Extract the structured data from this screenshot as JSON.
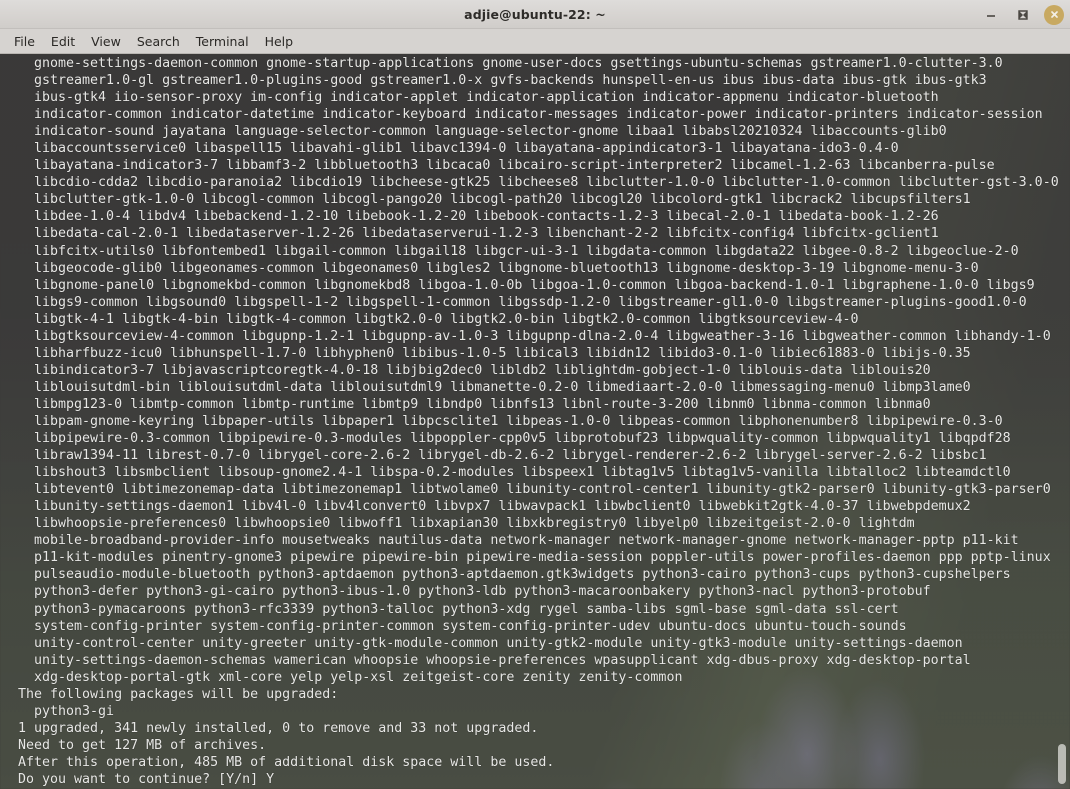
{
  "window": {
    "title": "adjie@ubuntu-22: ~",
    "controls": [
      {
        "name": "minimize",
        "glyph": "minimize-icon"
      },
      {
        "name": "maximize",
        "glyph": "maximize-icon"
      },
      {
        "name": "close",
        "glyph": "close-icon"
      }
    ],
    "close_button_color": "#c8a961",
    "titlebar_color": "#d6d3d0"
  },
  "menubar": {
    "items": [
      {
        "label": "File"
      },
      {
        "label": "Edit"
      },
      {
        "label": "View"
      },
      {
        "label": "Search"
      },
      {
        "label": "Terminal"
      },
      {
        "label": "Help"
      }
    ]
  },
  "terminal": {
    "background_color": "#3b3b38",
    "foreground_color": "#e8e8e6",
    "lines": [
      "  gnome-settings-daemon-common gnome-startup-applications gnome-user-docs gsettings-ubuntu-schemas gstreamer1.0-clutter-3.0",
      "  gstreamer1.0-gl gstreamer1.0-plugins-good gstreamer1.0-x gvfs-backends hunspell-en-us ibus ibus-data ibus-gtk ibus-gtk3",
      "  ibus-gtk4 iio-sensor-proxy im-config indicator-applet indicator-application indicator-appmenu indicator-bluetooth",
      "  indicator-common indicator-datetime indicator-keyboard indicator-messages indicator-power indicator-printers indicator-session",
      "  indicator-sound jayatana language-selector-common language-selector-gnome libaa1 libabsl20210324 libaccounts-glib0",
      "  libaccountsservice0 libaspell15 libavahi-glib1 libavc1394-0 libayatana-appindicator3-1 libayatana-ido3-0.4-0",
      "  libayatana-indicator3-7 libbamf3-2 libbluetooth3 libcaca0 libcairo-script-interpreter2 libcamel-1.2-63 libcanberra-pulse",
      "  libcdio-cdda2 libcdio-paranoia2 libcdio19 libcheese-gtk25 libcheese8 libclutter-1.0-0 libclutter-1.0-common libclutter-gst-3.0-0",
      "  libclutter-gtk-1.0-0 libcogl-common libcogl-pango20 libcogl-path20 libcogl20 libcolord-gtk1 libcrack2 libcupsfilters1",
      "  libdee-1.0-4 libdv4 libebackend-1.2-10 libebook-1.2-20 libebook-contacts-1.2-3 libecal-2.0-1 libedata-book-1.2-26",
      "  libedata-cal-2.0-1 libedataserver-1.2-26 libedataserverui-1.2-3 libenchant-2-2 libfcitx-config4 libfcitx-gclient1",
      "  libfcitx-utils0 libfontembed1 libgail-common libgail18 libgcr-ui-3-1 libgdata-common libgdata22 libgee-0.8-2 libgeoclue-2-0",
      "  libgeocode-glib0 libgeonames-common libgeonames0 libgles2 libgnome-bluetooth13 libgnome-desktop-3-19 libgnome-menu-3-0",
      "  libgnome-panel0 libgnomekbd-common libgnomekbd8 libgoa-1.0-0b libgoa-1.0-common libgoa-backend-1.0-1 libgraphene-1.0-0 libgs9",
      "  libgs9-common libgsound0 libgspell-1-2 libgspell-1-common libgssdp-1.2-0 libgstreamer-gl1.0-0 libgstreamer-plugins-good1.0-0",
      "  libgtk-4-1 libgtk-4-bin libgtk-4-common libgtk2.0-0 libgtk2.0-bin libgtk2.0-common libgtksourceview-4-0",
      "  libgtksourceview-4-common libgupnp-1.2-1 libgupnp-av-1.0-3 libgupnp-dlna-2.0-4 libgweather-3-16 libgweather-common libhandy-1-0",
      "  libharfbuzz-icu0 libhunspell-1.7-0 libhyphen0 libibus-1.0-5 libical3 libidn12 libido3-0.1-0 libiec61883-0 libijs-0.35",
      "  libindicator3-7 libjavascriptcoregtk-4.0-18 libjbig2dec0 libldb2 liblightdm-gobject-1-0 liblouis-data liblouis20",
      "  liblouisutdml-bin liblouisutdml-data liblouisutdml9 libmanette-0.2-0 libmediaart-2.0-0 libmessaging-menu0 libmp3lame0",
      "  libmpg123-0 libmtp-common libmtp-runtime libmtp9 libndp0 libnfs13 libnl-route-3-200 libnm0 libnma-common libnma0",
      "  libpam-gnome-keyring libpaper-utils libpaper1 libpcsclite1 libpeas-1.0-0 libpeas-common libphonenumber8 libpipewire-0.3-0",
      "  libpipewire-0.3-common libpipewire-0.3-modules libpoppler-cpp0v5 libprotobuf23 libpwquality-common libpwquality1 libqpdf28",
      "  libraw1394-11 librest-0.7-0 librygel-core-2.6-2 librygel-db-2.6-2 librygel-renderer-2.6-2 librygel-server-2.6-2 libsbc1",
      "  libshout3 libsmbclient libsoup-gnome2.4-1 libspa-0.2-modules libspeex1 libtag1v5 libtag1v5-vanilla libtalloc2 libteamdctl0",
      "  libtevent0 libtimezonemap-data libtimezonemap1 libtwolame0 libunity-control-center1 libunity-gtk2-parser0 libunity-gtk3-parser0",
      "  libunity-settings-daemon1 libv4l-0 libv4lconvert0 libvpx7 libwavpack1 libwbclient0 libwebkit2gtk-4.0-37 libwebpdemux2",
      "  libwhoopsie-preferences0 libwhoopsie0 libwoff1 libxapian30 libxkbregistry0 libyelp0 libzeitgeist-2.0-0 lightdm",
      "  mobile-broadband-provider-info mousetweaks nautilus-data network-manager network-manager-gnome network-manager-pptp p11-kit",
      "  p11-kit-modules pinentry-gnome3 pipewire pipewire-bin pipewire-media-session poppler-utils power-profiles-daemon ppp pptp-linux",
      "  pulseaudio-module-bluetooth python3-aptdaemon python3-aptdaemon.gtk3widgets python3-cairo python3-cups python3-cupshelpers",
      "  python3-defer python3-gi-cairo python3-ibus-1.0 python3-ldb python3-macaroonbakery python3-nacl python3-protobuf",
      "  python3-pymacaroons python3-rfc3339 python3-talloc python3-xdg rygel samba-libs sgml-base sgml-data ssl-cert",
      "  system-config-printer system-config-printer-common system-config-printer-udev ubuntu-docs ubuntu-touch-sounds",
      "  unity-control-center unity-greeter unity-gtk-module-common unity-gtk2-module unity-gtk3-module unity-settings-daemon",
      "  unity-settings-daemon-schemas wamerican whoopsie whoopsie-preferences wpasupplicant xdg-dbus-proxy xdg-desktop-portal",
      "  xdg-desktop-portal-gtk xml-core yelp yelp-xsl zeitgeist-core zenity zenity-common",
      "The following packages will be upgraded:",
      "  python3-gi",
      "1 upgraded, 341 newly installed, 0 to remove and 33 not upgraded.",
      "Need to get 127 MB of archives.",
      "After this operation, 485 MB of additional disk space will be used.",
      "Do you want to continue? [Y/n] Y"
    ],
    "summary": {
      "upgraded_count": "1",
      "newly_installed_count": "341",
      "to_remove_count": "0",
      "not_upgraded_count": "33",
      "download_size": "127 MB",
      "disk_space_used": "485 MB",
      "prompt_answer": "Y"
    }
  },
  "scrollbar": {
    "position": "bottom"
  }
}
